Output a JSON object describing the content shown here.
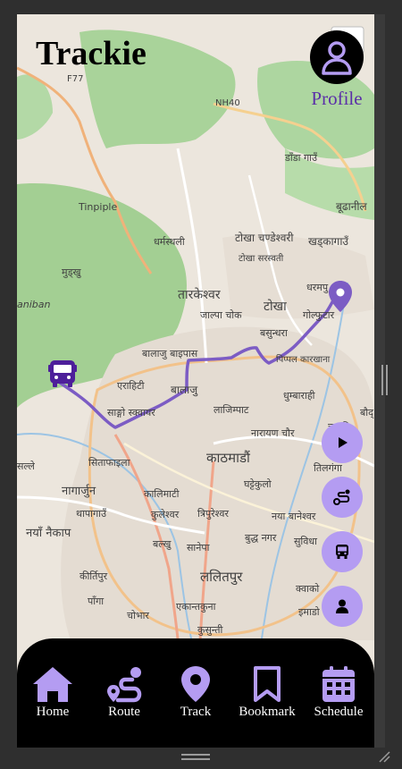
{
  "app": {
    "title": "Trackie"
  },
  "profile": {
    "label": "Profile"
  },
  "map": {
    "route_color": "#7c5cc4",
    "places": [
      "F77",
      "NH40",
      "डाँडा गाउँ",
      "बूढानील",
      "Tinpiple",
      "धर्मस्थली",
      "टोखा चण्डेश्वरी",
      "खड्कागाउँ",
      "टोखा सरस्वती",
      "मुड्खु",
      "aniban",
      "धरमपु",
      "तारकेश्वर",
      "टोखा",
      "जाल्पा चोक",
      "गोल्फुटार",
      "बसुन्धरा",
      "बालाजु बाइपास",
      "पिप्पल कारखाना",
      "एराहिटी",
      "बालाजु",
      "धुम्बाराही",
      "साङ्गो स्क्वायर",
      "लाजिम्पाट",
      "चाबहि",
      "बौद्",
      "नारायण चौर",
      "काठमाडौं",
      "सिताफाइला",
      "तिलगंगा",
      "सल्ले",
      "नागार्जुन",
      "कालिमाटी",
      "घट्टेकुलो",
      "थापागाउँ",
      "कुलेश्वर",
      "त्रिपुरेश्वर",
      "नया बानेश्वर",
      "नयाँ नैकाप",
      "बल्खु",
      "बुद्ध नगर",
      "सानेपा",
      "सुविधा",
      "कीर्तिपुर",
      "ललितपुर",
      "पाँगा",
      "क्वाको",
      "चोभार",
      "इमाडो",
      "एकान्तकुना",
      "कुसुन्ती"
    ]
  },
  "fabs": [
    {
      "name": "play",
      "icon": "play-icon"
    },
    {
      "name": "route",
      "icon": "route-icon"
    },
    {
      "name": "bus",
      "icon": "bus-icon"
    },
    {
      "name": "user",
      "icon": "user-icon"
    }
  ],
  "nav": [
    {
      "label": "Home",
      "icon": "home-icon"
    },
    {
      "label": "Route",
      "icon": "route-icon"
    },
    {
      "label": "Track",
      "icon": "location-pin-icon"
    },
    {
      "label": "Bookmark",
      "icon": "bookmark-icon"
    },
    {
      "label": "Schedule",
      "icon": "calendar-icon"
    }
  ],
  "colors": {
    "accent": "#b49cf2",
    "title_link": "#5b2fa8",
    "nav_bg": "#000000"
  }
}
